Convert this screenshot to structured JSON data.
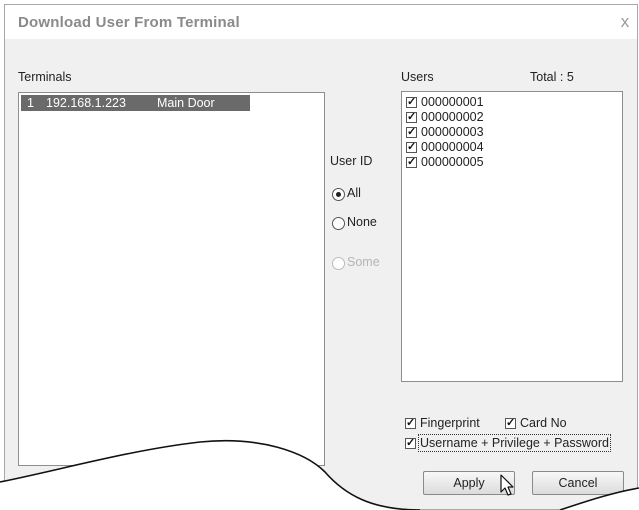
{
  "window": {
    "title": "Download User From Terminal",
    "close_glyph": "x"
  },
  "terminals": {
    "label": "Terminals",
    "rows": [
      {
        "index": "1",
        "ip": "192.168.1.223",
        "name": "Main Door"
      }
    ]
  },
  "user_id": {
    "label": "User ID",
    "options": [
      {
        "label": "All",
        "selected": true,
        "enabled": true
      },
      {
        "label": "None",
        "selected": false,
        "enabled": true
      },
      {
        "label": "Some",
        "selected": false,
        "enabled": false
      }
    ]
  },
  "users": {
    "label": "Users",
    "total": "Total : 5",
    "items": [
      "000000001",
      "000000002",
      "000000003",
      "000000004",
      "000000005"
    ]
  },
  "options": {
    "fingerprint": "Fingerprint",
    "card_no": "Card No",
    "username_privilege_password": "Username + Privilege + Password"
  },
  "buttons": {
    "apply": "Apply",
    "cancel": "Cancel"
  },
  "colors": {
    "selection": "#6a6a6a",
    "title": "#8a8a8a",
    "face": "#f0f0f0"
  }
}
